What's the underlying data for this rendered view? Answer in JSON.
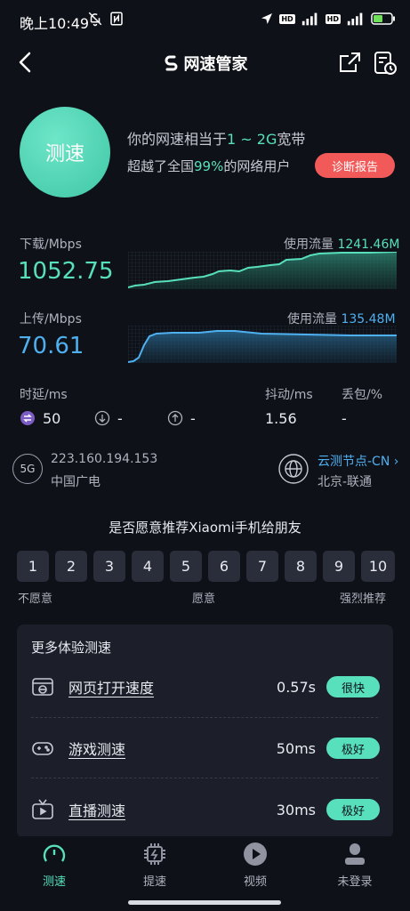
{
  "status_bar": {
    "time": "晚上10:49",
    "hd_badge": "HD",
    "network_5g": "5G",
    "battery_icon": "battery-charging-icon"
  },
  "header": {
    "title": "网速管家",
    "back_icon": "back-arrow-icon",
    "share_icon": "share-icon",
    "history_icon": "history-icon"
  },
  "speed_test": {
    "button_label": "测速",
    "equiv_prefix": "你的网速相当于",
    "equiv_value": "1 ~ 2G",
    "equiv_suffix": "宽带",
    "beat_prefix": "超越了全国",
    "beat_percent": "99%",
    "beat_suffix": "的网络用户",
    "diagnose_label": "诊断报告"
  },
  "download": {
    "label": "下载/Mbps",
    "value": "1052.75",
    "usage_label": "使用流量",
    "usage_value": "1241.46M",
    "color": "#58e0bd"
  },
  "upload": {
    "label": "上传/Mbps",
    "value": "70.61",
    "usage_label": "使用流量",
    "usage_value": "135.48M",
    "color": "#4fb0f0"
  },
  "metrics": {
    "latency_label": "时延/ms",
    "jitter_label": "抖动/ms",
    "loss_label": "丢包/%",
    "latency_value": "50",
    "down_latency": "-",
    "up_latency": "-",
    "jitter_value": "1.56",
    "loss_value": "-"
  },
  "network": {
    "type_badge": "5G",
    "ip": "223.160.194.153",
    "isp": "中国广电",
    "node_label": "云测节点-CN",
    "node_location": "北京-联通"
  },
  "recommend": {
    "question": "是否愿意推荐Xiaomi手机给朋友",
    "scores": [
      "1",
      "2",
      "3",
      "4",
      "5",
      "6",
      "7",
      "8",
      "9",
      "10"
    ],
    "scale_low": "不愿意",
    "scale_mid": "愿意",
    "scale_high": "强烈推荐"
  },
  "more_tests": {
    "title": "更多体验测速",
    "items": [
      {
        "name": "网页打开速度",
        "value": "0.57s",
        "tag": "很快",
        "icon": "webpage-icon"
      },
      {
        "name": "游戏测速",
        "value": "50ms",
        "tag": "极好",
        "icon": "gamepad-icon"
      },
      {
        "name": "直播测速",
        "value": "30ms",
        "tag": "极好",
        "icon": "tv-icon"
      }
    ]
  },
  "bottom_nav": {
    "items": [
      {
        "label": "测速",
        "icon": "speedometer-icon",
        "active": true
      },
      {
        "label": "提速",
        "icon": "chip-boost-icon",
        "active": false
      },
      {
        "label": "视频",
        "icon": "play-icon",
        "active": false
      },
      {
        "label": "未登录",
        "icon": "user-icon",
        "active": false
      }
    ]
  }
}
